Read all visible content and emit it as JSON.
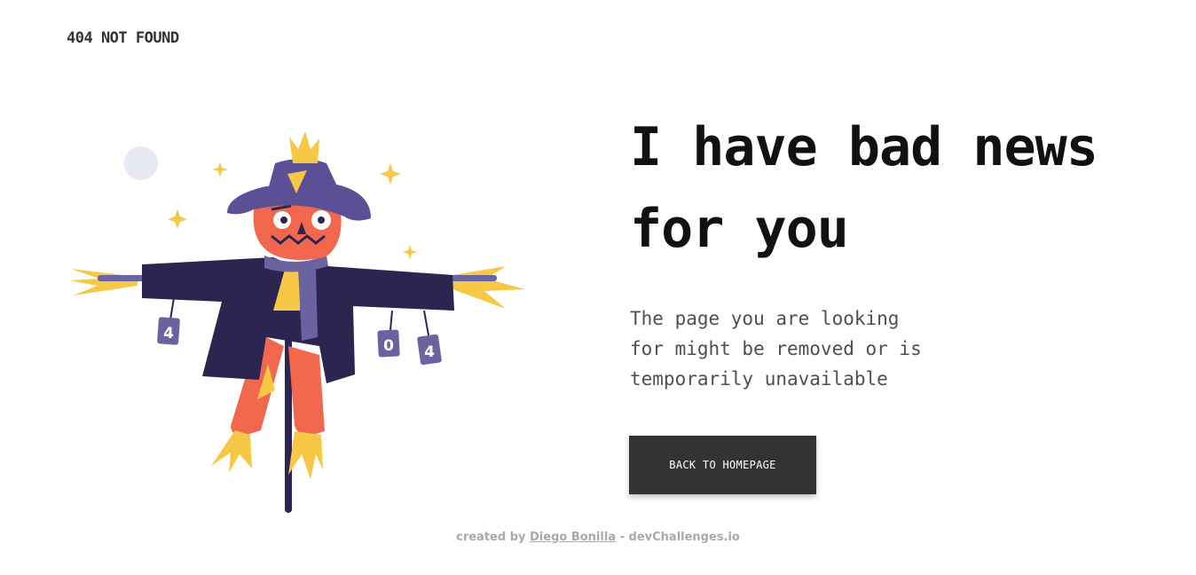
{
  "brand": {
    "text": "404 NOT FOUND"
  },
  "hero": {
    "headline_line1": "I have bad news",
    "headline_line2": "for you",
    "message_line1": "The page you are looking",
    "message_line2": "for might be removed or is",
    "message_line3": "temporarily unavailable",
    "button_label": "BACK TO HOMEPAGE"
  },
  "illustration": {
    "icon": "scarecrow-illustration",
    "can_labels": [
      "4",
      "0",
      "4"
    ]
  },
  "footer": {
    "prefix": "created by",
    "author": "Diego Bonilla",
    "separator": "-",
    "site": "devChallenges.io"
  },
  "colors": {
    "button_bg": "#333333",
    "hat": "#5b4f96",
    "coat": "#2b2550",
    "pumpkin": "#f2684e",
    "straw": "#f7c846",
    "moon": "#e6e8f4"
  }
}
